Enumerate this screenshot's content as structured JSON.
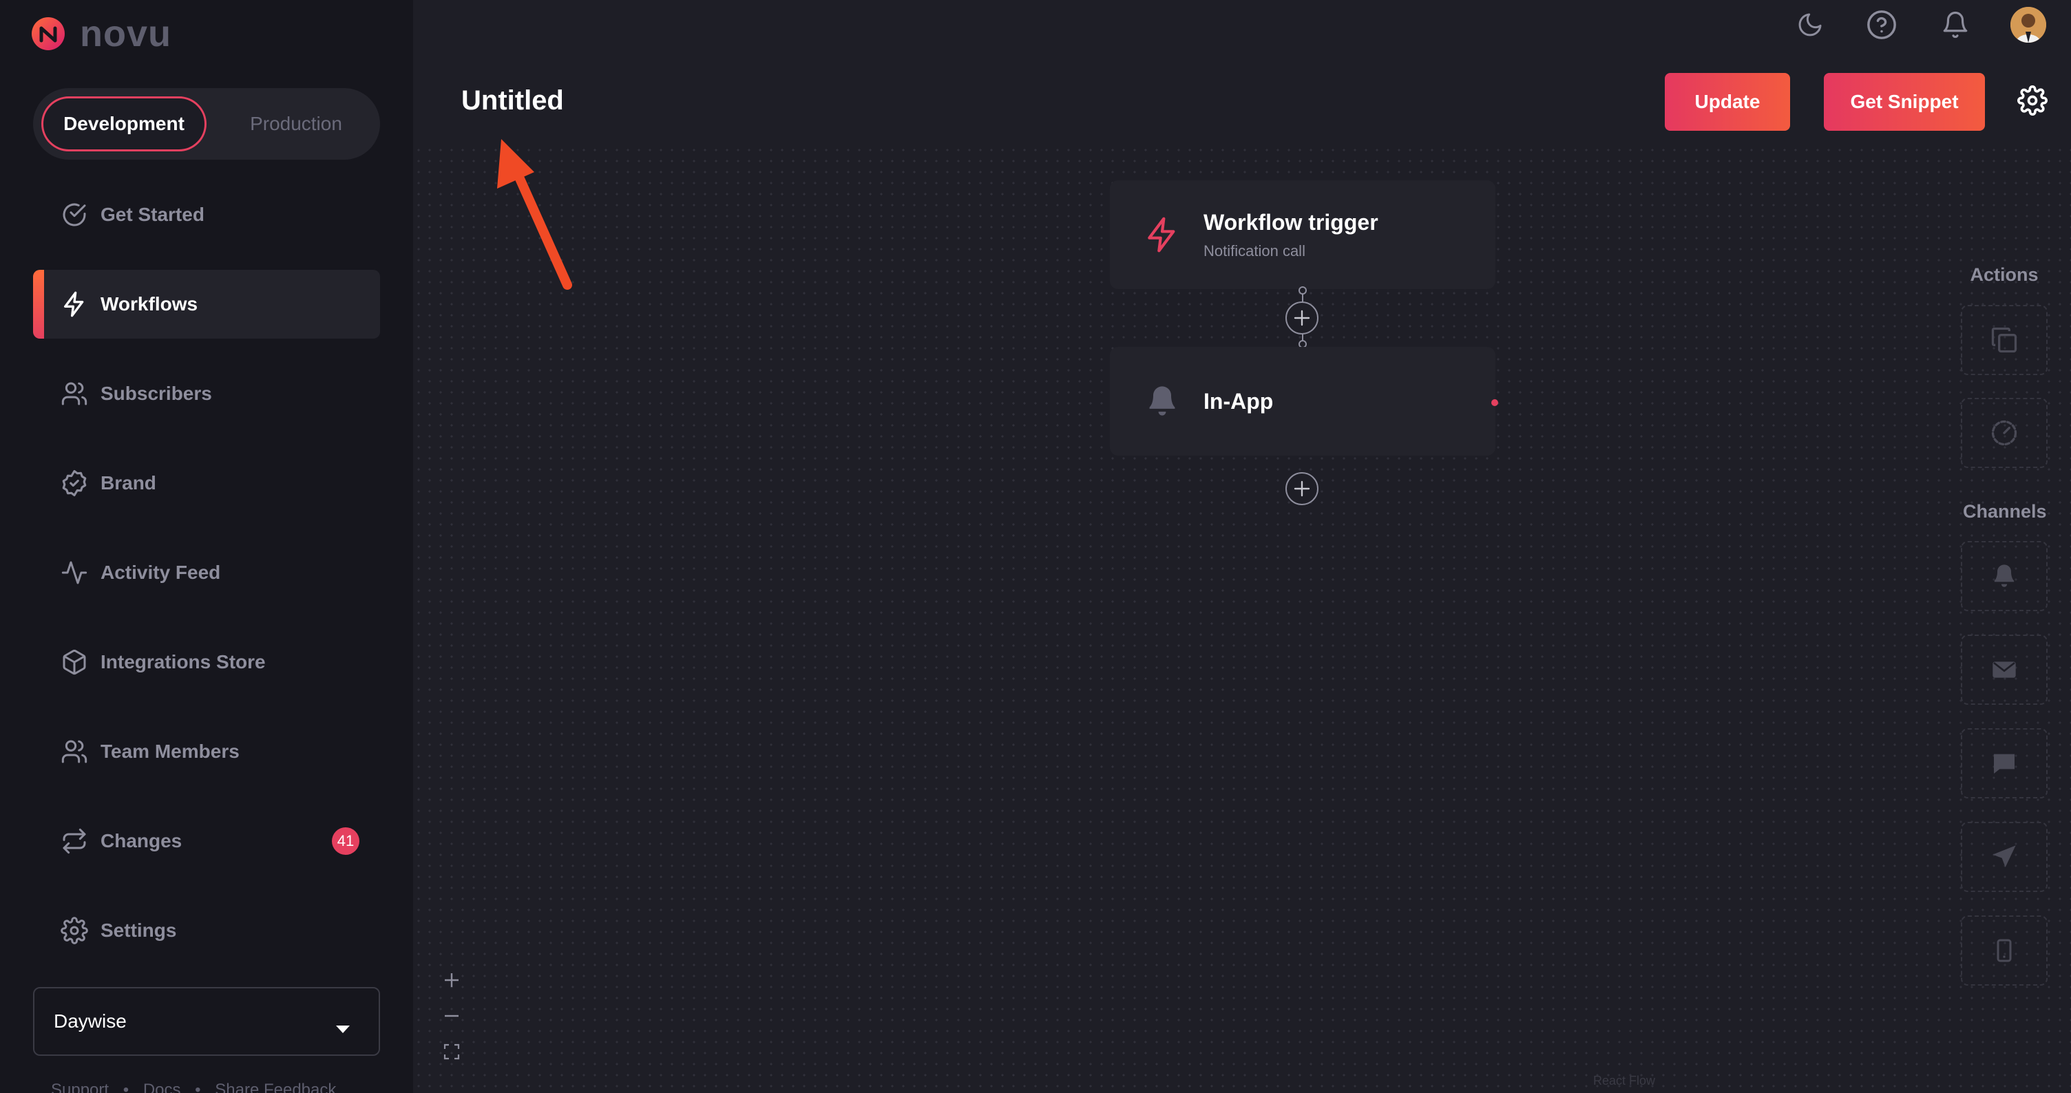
{
  "app": {
    "name": "novu",
    "brand_color": "#e5405f"
  },
  "environment": {
    "development_label": "Development",
    "production_label": "Production",
    "selected": "Development"
  },
  "sidebar": {
    "items": [
      {
        "label": "Get Started",
        "icon": "check-circle-icon"
      },
      {
        "label": "Workflows",
        "icon": "bolt-icon"
      },
      {
        "label": "Subscribers",
        "icon": "users-icon"
      },
      {
        "label": "Brand",
        "icon": "badge-check-icon"
      },
      {
        "label": "Activity Feed",
        "icon": "activity-icon"
      },
      {
        "label": "Integrations Store",
        "icon": "box-icon"
      },
      {
        "label": "Team Members",
        "icon": "users-icon"
      },
      {
        "label": "Changes",
        "icon": "repeat-icon",
        "badge": "41"
      },
      {
        "label": "Settings",
        "icon": "gear-icon"
      }
    ],
    "active": "Workflows",
    "organization": "Daywise",
    "footer": {
      "support": "Support",
      "docs": "Docs",
      "feedback": "Share Feedback",
      "separator": "•"
    }
  },
  "header": {
    "title": "Untitled",
    "update_label": "Update",
    "snippet_label": "Get Snippet"
  },
  "workflow": {
    "trigger_title": "Workflow trigger",
    "trigger_subtitle": "Notification call",
    "step_title": "In-App"
  },
  "right_panel": {
    "actions_heading": "Actions",
    "channels_heading": "Channels",
    "actions": [
      "copy-icon",
      "timer-icon"
    ],
    "channels": [
      "bell-icon",
      "mail-icon",
      "chat-icon",
      "send-icon",
      "mobile-icon"
    ]
  },
  "canvas": {
    "attribution": "React Flow"
  }
}
